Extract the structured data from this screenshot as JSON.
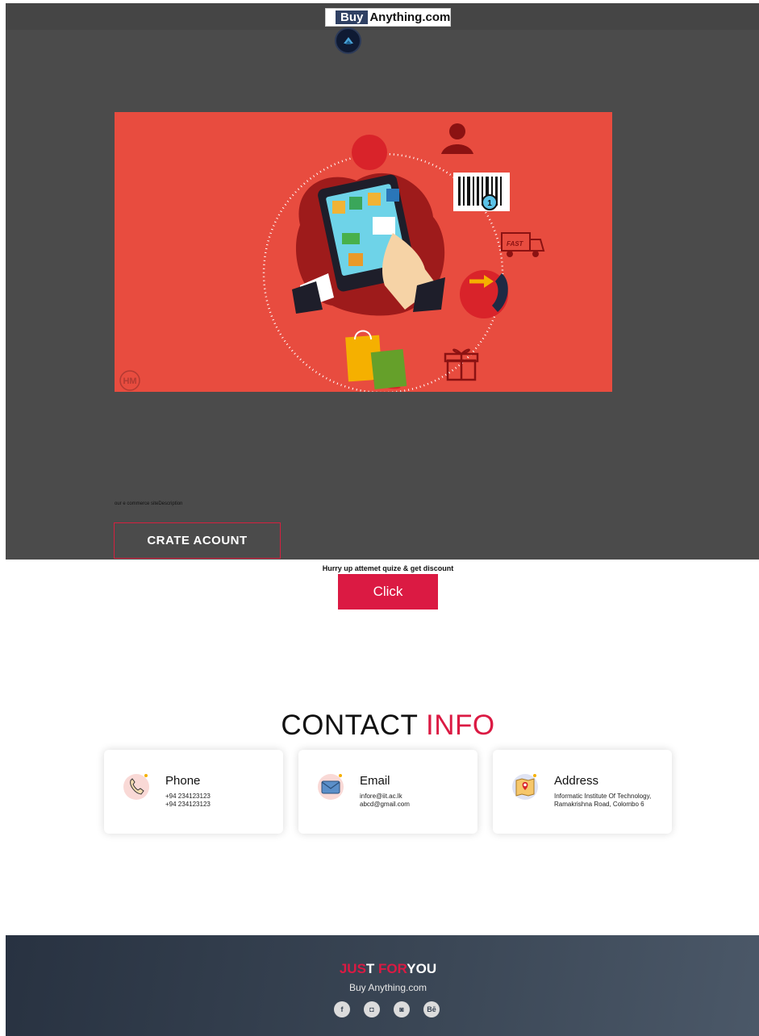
{
  "header": {
    "brand_buy": "Buy",
    "brand_rest": "Anything.com"
  },
  "banner": {
    "icons": [
      "tablet-shopping-icon",
      "support-agent-icon",
      "barcode-icon",
      "delivery-truck-icon",
      "phone-call-icon",
      "shopping-bags-icon",
      "gift-icon"
    ],
    "truck_text": "FAST",
    "badge_text": "1",
    "watermark": "HM"
  },
  "hero": {
    "description": "our e commerce siteDescription",
    "create_button": "CRATE ACOUNT"
  },
  "promo": {
    "text": "Hurry up attemet quize & get discount",
    "click_button": "Click"
  },
  "contact": {
    "title_main": "CONTACT",
    "title_accent": "INFO",
    "cards": [
      {
        "title": "Phone",
        "lines": [
          "+94 234123123",
          "+94 234123123"
        ],
        "icon": "phone-icon"
      },
      {
        "title": "Email",
        "lines": [
          "infore@iit.ac.lk",
          "abcd@gmail.com"
        ],
        "icon": "envelope-icon"
      },
      {
        "title": "Address",
        "lines": [
          "Informatic Institute Of Technology,",
          "Ramakrishna Road, Colombo 6"
        ],
        "icon": "map-pin-icon"
      }
    ]
  },
  "footer": {
    "jus": "JUS",
    "t": "T ",
    "for": "FOR",
    "you": "YOU",
    "subtitle": "Buy Anything.com",
    "socials": [
      {
        "name": "facebook",
        "glyph": "f"
      },
      {
        "name": "instagram",
        "glyph": "◘"
      },
      {
        "name": "twitter",
        "glyph": "◙"
      },
      {
        "name": "behance",
        "glyph": "Bē"
      }
    ]
  },
  "colors": {
    "accent": "#db1a43",
    "hero_bg": "#4b4b4b",
    "banner_bg": "#e84c3f",
    "brand_dark": "#2f4063"
  }
}
